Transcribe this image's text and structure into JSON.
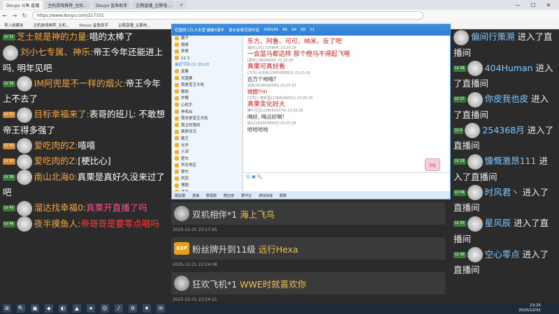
{
  "browser": {
    "tabs": [
      "Douyu 斗鱼 直播",
      "主机游戏推荐_主机...",
      "Douyu 鲨鱼助手",
      "企鹅直播_企鹅电...",
      "+"
    ],
    "url": "https://www.douyu.com/217331",
    "bookmarks": [
      "导入收藏夹",
      "主机游戏推荐_主机...",
      "Douyu 鲨鱼助手",
      "企鹅直播_企鹅电..."
    ],
    "minimize": "—",
    "maximize": "☐",
    "close": "✕"
  },
  "left_chat": [
    {
      "badge": "LV 32",
      "user": "芝士就是神的力量:",
      "text": "唱的太棒了",
      "lines": 1
    },
    {
      "badge": "LV 31",
      "user": "刘小七专属、神乐:",
      "text": "帝王今年还能进上吗, 明年见吧",
      "lines": 2
    },
    {
      "badge": "LV 36",
      "user": "IM阿兜是不一样的烟火:",
      "text": "帝王今年上不去了",
      "lines": 2
    },
    {
      "badge": "LV 33",
      "user": "目标幸福来了:",
      "text": "表哥的班儿: 不敢想帝王得多强了",
      "lines": 2
    },
    {
      "badge": "LV 34",
      "user": "爱吃肉的Z:",
      "text": "嘻嘻",
      "lines": 1
    },
    {
      "badge": "LV 35",
      "user": "爱吃肉的Z:",
      "text": "[梗比心]",
      "lines": 1
    },
    {
      "badge": "LV 36",
      "user": "南山北海0:",
      "text": "真栗是真好久没来过了吧",
      "lines": 2
    },
    {
      "badge": "LV 43",
      "user": "溜达找幸福0:",
      "text": "真栗开直播了吗",
      "lines": 2
    },
    {
      "badge": "LV 46",
      "user": "夜半摸鱼人:",
      "text": "帝哥哥是要零点唱吗",
      "lines": 2
    }
  ],
  "right_chat": [
    {
      "badge": "LV 44",
      "user": "偏间行策溯",
      "text": "进入了直播间"
    },
    {
      "badge": "LV 38",
      "user": "404Human",
      "text": "进入了直播间"
    },
    {
      "badge": "LV 37",
      "user": "你皮我也皮",
      "text": "进入了直播间"
    },
    {
      "badge": "LV 4",
      "user": "254368月",
      "text": "进入了直播间"
    },
    {
      "badge": "LV 29",
      "user": "慷慨激昂111",
      "text": "进入了直播间"
    },
    {
      "badge": "LV 44",
      "user": "时风君丶",
      "text": "进入了直播间"
    },
    {
      "badge": "LV 35",
      "user": "星风辰",
      "text": "进入了直播间"
    },
    {
      "badge": "LV 36",
      "user": "空心零点",
      "text": "进入了直播间"
    }
  ],
  "mid_feed": [
    {
      "time": "",
      "user": "双机相伴*1",
      "text": "海上飞鸟",
      "icon": "avatar"
    },
    {
      "time": "2025-12-31 23:17:45",
      "user": "粉丝牌升到11级",
      "text": "远行Hexa",
      "icon": "exp"
    },
    {
      "time": "2025-12-31 23:24:08",
      "user": "狂欢飞机*1",
      "text": "WWE时就喜欢你",
      "icon": "avatar"
    },
    {
      "time": "2025-12-31 23:24:21",
      "user": "",
      "text": "",
      "icon": ""
    }
  ],
  "qq_window": {
    "title_items": [
      "任国网工队大本营.嫂嫂4周年",
      "家乡前辈花锦年高",
      "408189",
      "86",
      "94",
      "88",
      "11"
    ],
    "sidebar_header": "最近节目 (1) 16:23",
    "sidebar_rows": [
      "嫂子",
      "翔哥",
      "来哥",
      "12.3",
      "最近节目 (1) 16:23",
      "真果",
      "灵菠萝",
      "我是宝玉大哈",
      "微软",
      "柠檬",
      "心机手",
      "争鸣台",
      "我本是宝玉大哈",
      "我主的我的",
      "激昂龙乌",
      "霸王",
      "光华",
      "人间",
      "楚东",
      "世北地区",
      "翠竹",
      "尚武",
      "博狼",
      "凌风",
      "落影",
      "明月",
      "光华",
      "刻舟"
    ],
    "chat": [
      {
        "who": "",
        "body": "东方、阿鲁、可可、纳米、反了吧",
        "style": "big"
      },
      {
        "who": "福州(1551720964) 23:25:28",
        "body": "一会蓝马都这样 那个橙马不得起飞咯",
        "style": "big"
      },
      {
        "who": "[网宇] (8608400) 23:25:30",
        "body": "真栗可真好看",
        "style": "big"
      },
      {
        "who": "CSTG-水天帆(1065438853) 23:25:31",
        "body": "百万个吻嘻?",
        "style": "body"
      },
      {
        "who": "追风(3016635580) 23:25:33",
        "body": "微醺!!m",
        "style": "body"
      },
      {
        "who": "CSTG一麦的团(1369168921) 23:25:33",
        "body": "真栗变化好大",
        "style": "big"
      },
      {
        "who": "推牛豆豆(2280420774) 23:25:35",
        "body": "喝好, 喝点好啊!",
        "style": "body"
      },
      {
        "who": "铁山(2040549550) 23:25:38",
        "body": "哈哈哈哈",
        "style": "body"
      }
    ],
    "coin": "5元",
    "bottom": [
      "朋友圈",
      "直播",
      "群视频",
      "群应用",
      "群作业",
      "游戏加速",
      "群聊"
    ]
  },
  "taskbar": {
    "icons": [
      "⊞",
      "🔍",
      "▣",
      "◆",
      "◐",
      "▲",
      "★",
      "☺",
      "♪",
      "⚙",
      "♦",
      "✉"
    ],
    "time": "23:25",
    "date": "2025/12/31"
  }
}
